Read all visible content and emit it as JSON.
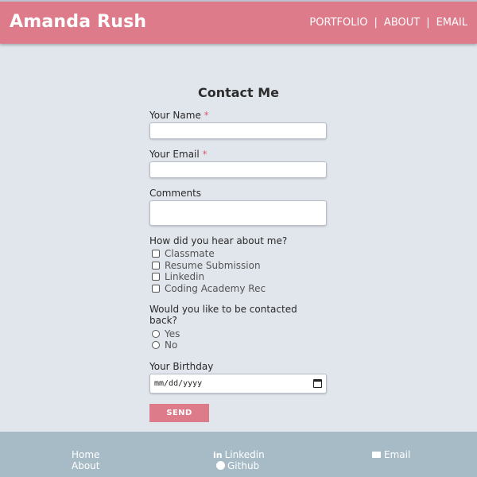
{
  "header": {
    "brand": "Amanda Rush",
    "nav": [
      "PORTFOLIO",
      "ABOUT",
      "EMAIL"
    ],
    "separator": "|"
  },
  "form": {
    "title": "Contact Me",
    "name_label": "Your Name",
    "email_label": "Your Email",
    "required_mark": "*",
    "comments_label": "Comments",
    "hear_label": "How did you hear about me?",
    "hear_options": [
      "Classmate",
      "Resume Submission",
      "Linkedin",
      "Coding Academy Rec"
    ],
    "contact_label": "Would you like to be contacted back?",
    "contact_options": [
      "Yes",
      "No"
    ],
    "birthday_label": "Your Birthday",
    "birthday_placeholder": "mm/dd/yyyy",
    "send_label": "SEND"
  },
  "footer": {
    "home": "Home",
    "about": "About",
    "linkedin": "Linkedin",
    "github": "Github",
    "email": "Email"
  },
  "colors": {
    "accent": "#de7b8b",
    "background": "#e1e5ec",
    "footer": "#a7bbc7"
  }
}
